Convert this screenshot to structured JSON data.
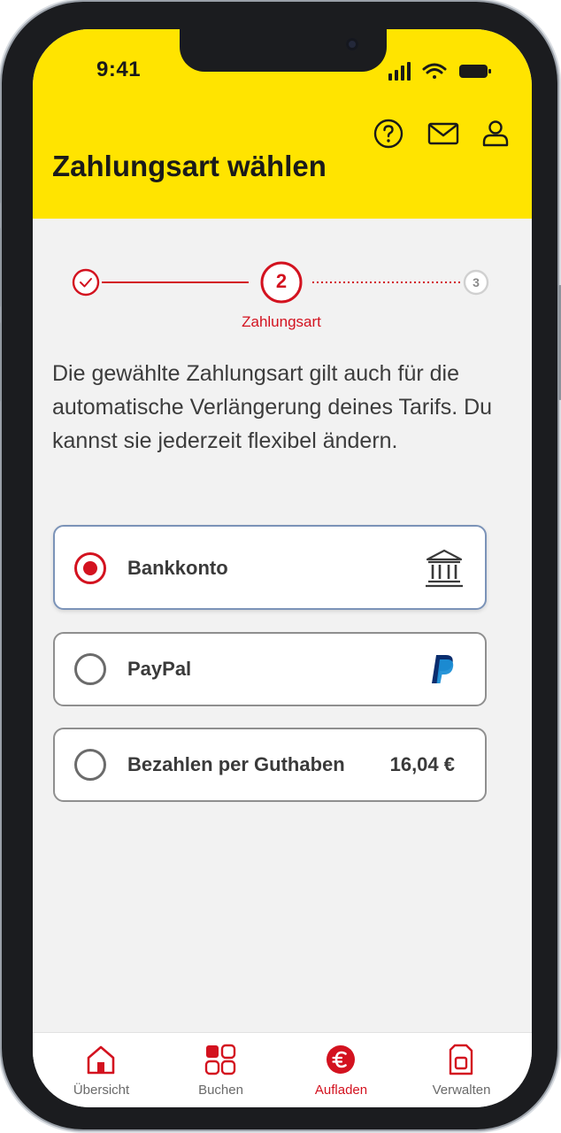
{
  "status_bar": {
    "time": "9:41"
  },
  "header": {
    "title": "Zahlungsart wählen",
    "icons": [
      "help-icon",
      "mail-icon",
      "user-icon"
    ]
  },
  "stepper": {
    "steps": [
      {
        "number": "1",
        "state": "done"
      },
      {
        "number": "2",
        "state": "current",
        "label": "Zahlungsart"
      },
      {
        "number": "3",
        "state": "upcoming"
      }
    ]
  },
  "description": "Die gewählte Zahlungsart gilt auch für die automatische Verlängerung deines Tarifs. Du kannst sie jederzeit flexibel ändern.",
  "payment_options": [
    {
      "label": "Bankkonto",
      "selected": true,
      "icon": "bank-icon"
    },
    {
      "label": "PayPal",
      "selected": false,
      "icon": "paypal-icon"
    },
    {
      "label": "Bezahlen per Guthaben",
      "selected": false,
      "amount": "16,04 €"
    }
  ],
  "tabbar": {
    "items": [
      {
        "label": "Übersicht",
        "icon": "home-icon",
        "active": false
      },
      {
        "label": "Buchen",
        "icon": "grid-icon",
        "active": false
      },
      {
        "label": "Aufladen",
        "icon": "euro-icon",
        "active": true
      },
      {
        "label": "Verwalten",
        "icon": "sim-card-icon",
        "active": false
      }
    ]
  },
  "colors": {
    "brand_yellow": "#ffe400",
    "accent_red": "#d3121f",
    "selected_border": "#7b93b8"
  }
}
